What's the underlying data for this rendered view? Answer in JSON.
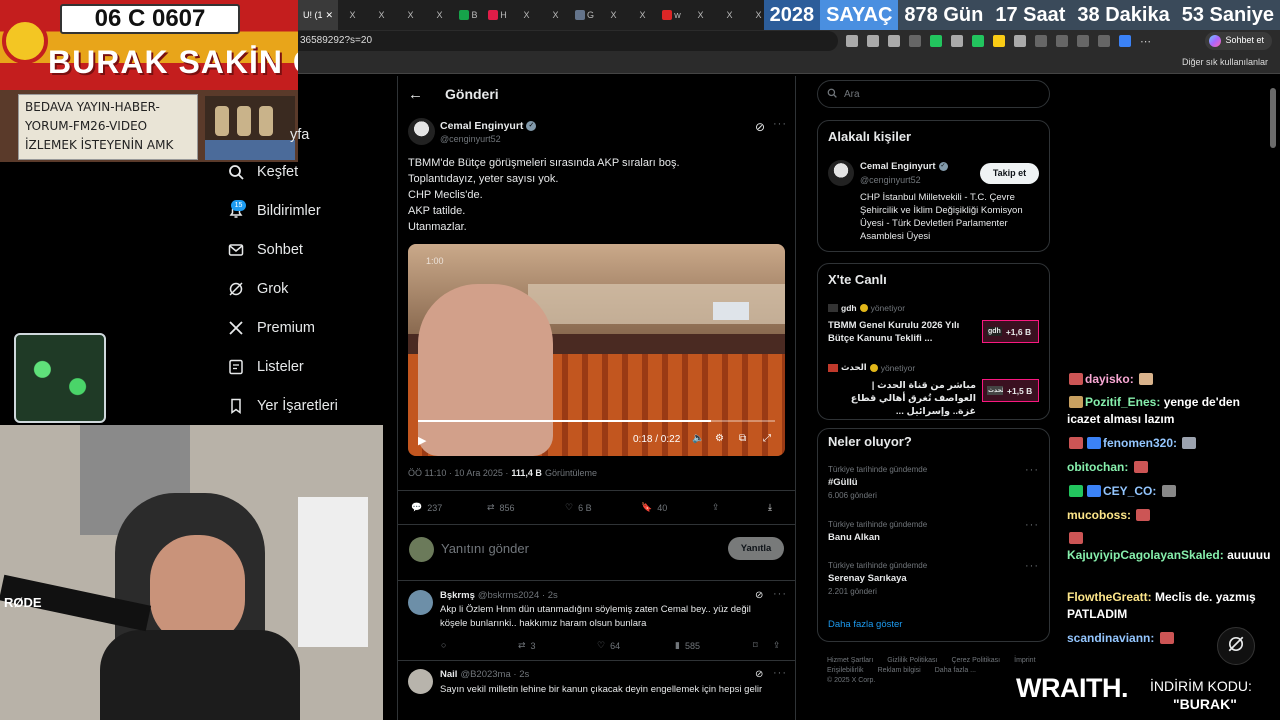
{
  "browser": {
    "tabs": [
      "U! (1",
      "X",
      "X",
      "X",
      "X",
      "B",
      "H",
      "X",
      "X",
      "G",
      "X",
      "X",
      "w",
      "X",
      "X",
      "X"
    ],
    "url": "36589292?s=20",
    "bookmarks_other": "Diğer sık kullanılanlar",
    "chat_button": "Sohbet et"
  },
  "countdown": {
    "year": "2028",
    "label": "SAYAÇ",
    "days": "878 Gün",
    "hours": "17 Saat",
    "minutes": "38 Dakika",
    "seconds": "53 Saniye"
  },
  "stream_overlay": {
    "plate": "06 C 0607",
    "banner": "BURAK SAKİN OL",
    "sign_lines": [
      "BEDAVA YAYIN-HABER-",
      "YORUM-FM26-VIDEO",
      "İZLEMEK İSTEYENİN AMK"
    ],
    "mic_brand": "RØDE",
    "sponsor": "WRAITH.",
    "discount_label": "İNDİRİM KODU:",
    "discount_code": "\"BURAK\""
  },
  "nav": {
    "home_partial": "yfa",
    "items": [
      {
        "label": "Keşfet",
        "icon": "search-icon"
      },
      {
        "label": "Bildirimler",
        "icon": "bell-icon",
        "badge": "15"
      },
      {
        "label": "Sohbet",
        "icon": "mail-icon"
      },
      {
        "label": "Grok",
        "icon": "grok-icon"
      },
      {
        "label": "Premium",
        "icon": "x-logo-icon"
      },
      {
        "label": "Listeler",
        "icon": "list-icon"
      },
      {
        "label": "Yer İşaretleri",
        "icon": "bookmark-icon"
      }
    ]
  },
  "post": {
    "header": "Gönderi",
    "author_name": "Cemal Enginyurt",
    "author_handle": "@cenginyurt52",
    "text_lines": [
      "TBMM'de Bütçe görüşmeleri sırasında AKP sıraları boş.",
      "Toplantıdayız, yeter sayısı yok.",
      "CHP Meclis'de.",
      "AKP tatilde.",
      "Utanmazlar."
    ],
    "video_time_badge": "1:00",
    "video_progress": "0:18 / 0:22",
    "video_progress_fraction": 0.82,
    "meta_time": "ÖÖ 11:10 · 10 Ara 2025 ·",
    "views": "111,4 B",
    "views_label": "Görüntüleme",
    "replies": "237",
    "reposts": "856",
    "likes": "6 B",
    "bookmarks": "40",
    "reply_placeholder": "Yanıtını gönder",
    "reply_button": "Yanıtla"
  },
  "replies": [
    {
      "name": "Bşkrmş",
      "handle": "@bskrms2024 · 2s",
      "text": "Akp li Özlem Hnm dün utanmadığını söylemiş zaten Cemal bey.. yüz değil köşele bunlarınki.. hakkımız haram olsun bunlara",
      "retweets": "3",
      "likes": "64",
      "views": "585"
    },
    {
      "name": "Nail",
      "handle": "@B2023ma · 2s",
      "text": "Sayın vekil milletin lehine bir kanun çıkacak deyin engellemek için hepsi gelir"
    }
  ],
  "search": {
    "placeholder": "Ara"
  },
  "related": {
    "title": "Alakalı kişiler",
    "name": "Cemal Enginyurt",
    "handle": "@cenginyurt52",
    "follow": "Takip et",
    "bio": "CHP İstanbul Milletvekili - T.C. Çevre Şehircilik ve İklim Değişikliği Komisyon Üyesi - Türk Devletleri Parlamenter Asamblesi Üyesi"
  },
  "live": {
    "title": "X'te Canlı",
    "items": [
      {
        "host": "gdh",
        "role": "yönetiyor",
        "title": "TBMM Genel Kurulu 2026 Yılı Bütçe Kanunu Teklifi ...",
        "count": "+1,6 B",
        "thumb": "gdh"
      },
      {
        "host": "الحدث",
        "role": "yönetiyor",
        "title": "مباشر من قناة الحدث | العواصف تُغرق أهالي قطاع غزة.. وإسرائيل ...",
        "count": "+1,5 B",
        "thumb": "الحدث"
      }
    ]
  },
  "trends": {
    "title": "Neler oluyor?",
    "items": [
      {
        "context": "Türkiye tarihinde gündemde",
        "name": "#Güllü",
        "count": "6.006 gönderi"
      },
      {
        "context": "Türkiye tarihinde gündemde",
        "name": "Banu Alkan",
        "count": ""
      },
      {
        "context": "Türkiye tarihinde gündemde",
        "name": "Serenay Sarıkaya",
        "count": "2.201 gönderi"
      }
    ],
    "more": "Daha fazla göster"
  },
  "footer": {
    "links": [
      "Hizmet Şartları",
      "Gizlilik Politikası",
      "Çerez Politikası",
      "İmprint",
      "Erişilebilirlik",
      "Reklam bilgisi",
      "Daha fazla ..."
    ],
    "copyright": "© 2025 X Corp."
  },
  "chat": [
    {
      "user": "dayisko:",
      "msg": "",
      "color": "#f9a8d4"
    },
    {
      "user": "Pozitif_Enes:",
      "msg": "yenge de'den icazet alması lazım",
      "color": "#86efac"
    },
    {
      "user": "fenomen320:",
      "msg": "",
      "color": "#93c5fd"
    },
    {
      "user": "obitochan:",
      "msg": "",
      "color": "#86efac"
    },
    {
      "user": "CEY_CO:",
      "msg": "",
      "color": "#93c5fd"
    },
    {
      "user": "mucoboss:",
      "msg": "",
      "color": "#fde68a"
    },
    {
      "user": "KajuyiyipCagolayanSkaled:",
      "msg": "auuuuu",
      "color": "#86efac"
    },
    {
      "user": "FlowtheGreatt:",
      "msg": "Meclis de. yazmış PATLADIM",
      "color": "#fde68a"
    },
    {
      "user": "scandinaviann:",
      "msg": "",
      "color": "#93c5fd"
    }
  ]
}
